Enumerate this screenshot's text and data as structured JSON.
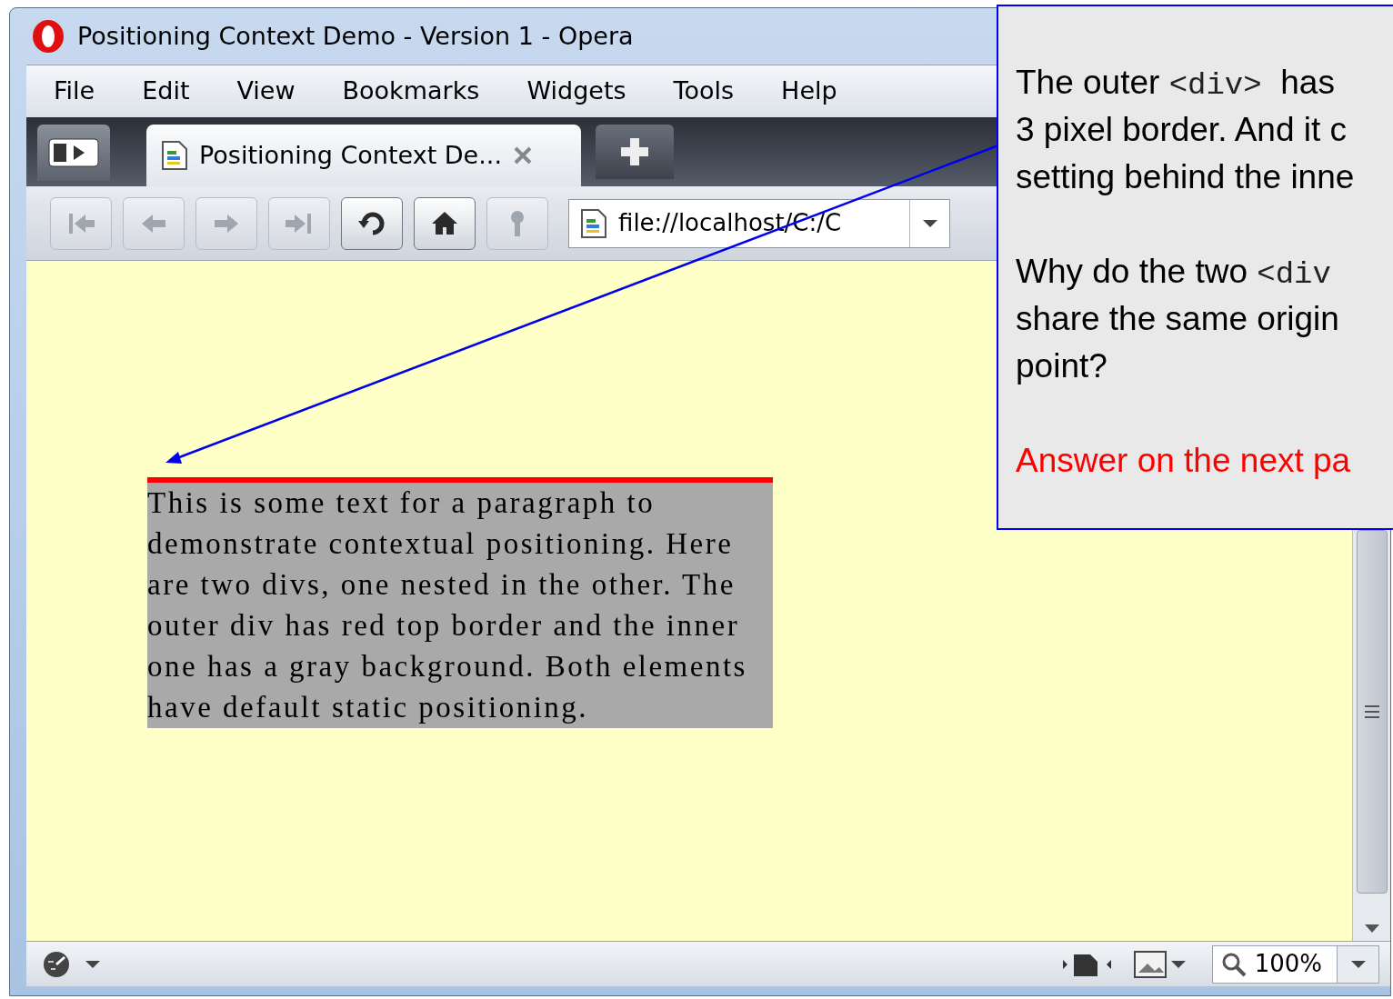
{
  "window": {
    "title": "Positioning Context Demo - Version 1 - Opera"
  },
  "menu": [
    {
      "label": "File"
    },
    {
      "label": "Edit"
    },
    {
      "label": "View"
    },
    {
      "label": "Bookmarks"
    },
    {
      "label": "Widgets"
    },
    {
      "label": "Tools"
    },
    {
      "label": "Help"
    }
  ],
  "tabs": [
    {
      "label": "Positioning Context De...",
      "selected": true
    }
  ],
  "toolbar": {
    "buttons": [
      {
        "kind": "rewind",
        "disabled": true
      },
      {
        "kind": "back",
        "disabled": true
      },
      {
        "kind": "forward",
        "disabled": true
      },
      {
        "kind": "fast-forward",
        "disabled": true
      },
      {
        "kind": "reload",
        "disabled": false
      },
      {
        "kind": "home",
        "disabled": false
      },
      {
        "kind": "key",
        "disabled": true
      }
    ],
    "address": "file://localhost/C:/C"
  },
  "page": {
    "paragraph": "This is some text for a paragraph to demonstrate contextual positioning. Here are two divs, one nested in the other. The outer div has red top border and the inner one has a gray background. Both elements have default static positioning."
  },
  "status_bar": {
    "zoom": "100%"
  },
  "callout": {
    "lines": [
      [
        {
          "kind": "plain",
          "text": "The outer "
        },
        {
          "kind": "code",
          "text": "<div>"
        },
        {
          "kind": "plain",
          "text": "  has"
        }
      ],
      [
        {
          "kind": "plain",
          "text": "3 pixel border. And it c"
        }
      ],
      [
        {
          "kind": "plain",
          "text": "setting behind the inne"
        }
      ],
      [
        {
          "kind": "plain",
          "text": "Why do the two ",
          "gap_before": true
        },
        {
          "kind": "code",
          "text": "<div"
        }
      ],
      [
        {
          "kind": "plain",
          "text": "share the same origin"
        }
      ],
      [
        {
          "kind": "plain",
          "text": "point?"
        }
      ],
      [
        {
          "kind": "answer",
          "text": "Answer on the next pa",
          "gap_before": true
        }
      ]
    ]
  }
}
